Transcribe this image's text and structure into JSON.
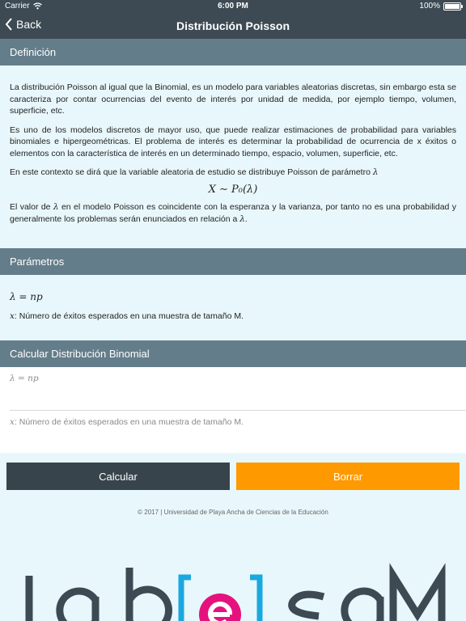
{
  "status_bar": {
    "carrier": "Carrier",
    "time": "6:00 PM",
    "battery": "100%"
  },
  "nav": {
    "back_label": "Back",
    "title": "Distribución Poisson"
  },
  "definicion": {
    "header": "Definición",
    "p1": "La distribución Poisson al igual que la Binomial, es un modelo para variables aleatorias discretas, sin embargo esta se caracteriza por contar ocurrencias del evento de interés por unidad de medida, por ejemplo tiempo, volumen, superficie, etc.",
    "p2": "Es uno de los modelos discretos de mayor uso, que puede realizar estimaciones de probabilidad para variables binomiales e hipergeométricas. El problema de interés es determinar la probabilidad de ocurrencia de x éxitos o elementos con la característica de interés en un determinado tiempo, espacio, volumen, superficie, etc.",
    "p3_text": "En este contexto se dirá que la variable aleatoria de estudio se distribuye Poisson de parámetro",
    "p3_symbol": "λ",
    "formula": "X ∼ P₀(λ)",
    "p4_a": "El valor de",
    "p4_symbol": "λ",
    "p4_b": "en el modelo Poisson es coincidente con la esperanza y la varianza, por tanto no es una probabilidad y generalmente los problemas serán enunciados en relación a",
    "p4_symbol_end": "λ",
    "p4_end": "."
  },
  "parametros": {
    "header": "Parámetros",
    "formula": "λ = np",
    "x_symbol": "x",
    "x_text": ": Número de éxitos esperados en una muestra de tamaño M."
  },
  "calcular": {
    "header": "Calcular Distribución Binomial",
    "lambda_placeholder": "λ = np",
    "x_placeholder_symbol": "x",
    "x_placeholder": ": Número de éxitos esperados en una muestra de tamaño M."
  },
  "buttons": {
    "calcular": "Calcular",
    "borrar": "Borrar"
  },
  "footer": "© 2017 | Universidad de Playa Ancha de Ciencias de la Educación",
  "logo": {
    "text": "Lab[e]saM"
  },
  "colors": {
    "nav_bg": "#3d4a53",
    "section_header_bg": "#647d8a",
    "page_bg": "#e8f7fb",
    "calcular_button": "#37444c",
    "borrar_button": "#ff9900",
    "logo_accent": "#e5127d",
    "logo_bracket": "#1aa8e0"
  }
}
